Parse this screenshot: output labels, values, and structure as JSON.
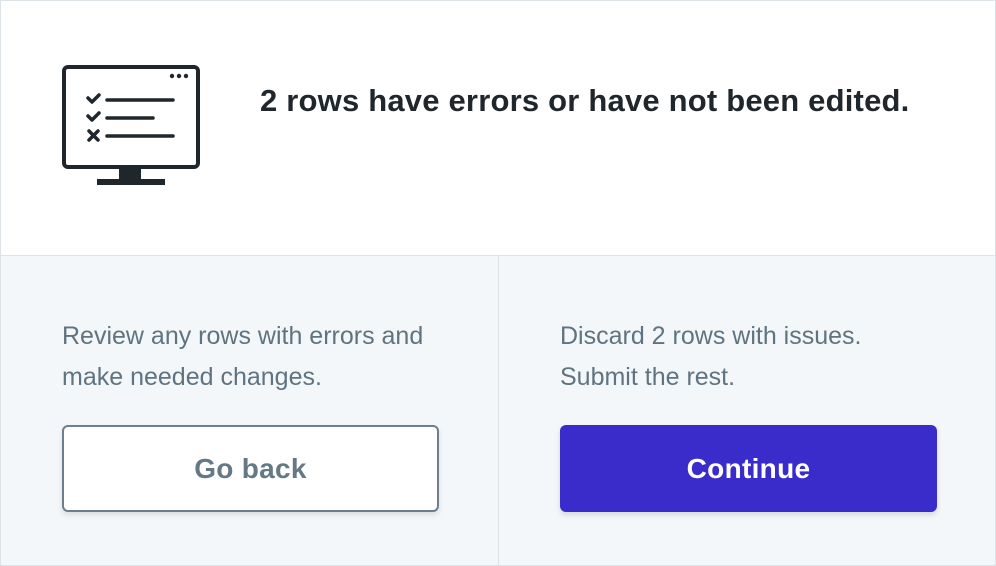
{
  "header": {
    "icon": "monitor-checklist-icon",
    "title": "2 rows have errors or have not been edited."
  },
  "options": {
    "go_back": {
      "description": "Review any rows with errors and make needed changes.",
      "button_label": "Go back"
    },
    "continue": {
      "description": "Discard 2 rows with issues. Submit the rest.",
      "button_label": "Continue"
    }
  },
  "colors": {
    "title_text": "#1f262c",
    "muted_text": "#5f7380",
    "panel_background": "#f4f7fa",
    "divider": "#dde2e7",
    "secondary_button_border": "#6d7f8c",
    "primary_button": "#3a2ccb",
    "primary_button_text": "#ffffff"
  }
}
